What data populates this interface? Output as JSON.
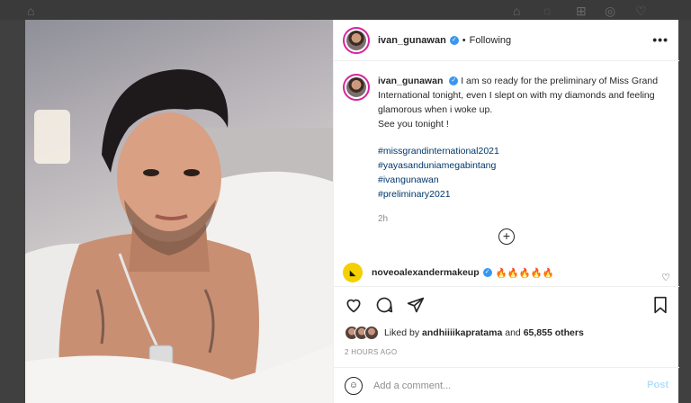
{
  "post": {
    "username": "ivan_gunawan",
    "follow_status": "Following",
    "dot": "•",
    "more_label": "•••",
    "verified_glyph": "✓",
    "caption": "I am so ready for the preliminary of Miss Grand International tonight, even I slept on with my diamonds and feeling glamorous when i woke up.",
    "caption_line2": "See you tonight !",
    "hashtags": [
      "#missgrandinternational2021",
      "#yayasanduniamegabintang",
      "#ivangunawan",
      "#preliminary2021"
    ],
    "caption_time": "2h",
    "load_more_glyph": "+"
  },
  "comment": {
    "username": "noveoalexandermakeup",
    "text": "🔥🔥🔥🔥🔥",
    "avatar_glyph": "◣"
  },
  "likes": {
    "liked_by_label": "Liked by",
    "liked_by_user": "andhiiiikapratama",
    "and_label": "and",
    "others": "65,855 others"
  },
  "timestamp": "2 HOURS AGO",
  "compose": {
    "placeholder": "Add a comment...",
    "post_label": "Post",
    "emoji_glyph": "☺"
  },
  "icons": {
    "heart": "heart-icon",
    "comment": "comment-icon",
    "share": "share-icon",
    "bookmark": "bookmark-icon"
  },
  "colors": {
    "link": "#00376b",
    "verified": "#3897f0",
    "post_disabled": "#b2dffc",
    "story_ring": "#d6249f"
  }
}
